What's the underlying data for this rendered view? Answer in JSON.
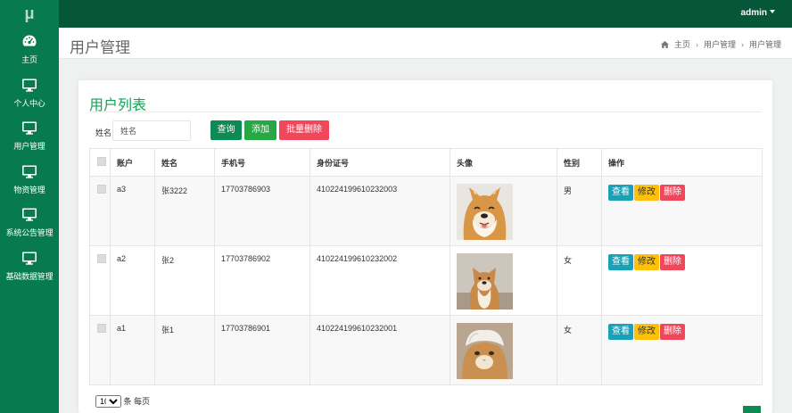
{
  "app": {
    "logo": "μ",
    "user": "admin"
  },
  "sidebar": {
    "items": [
      {
        "label": "主页",
        "icon": "dashboard-icon"
      },
      {
        "label": "个人中心",
        "icon": "monitor-icon"
      },
      {
        "label": "用户管理",
        "icon": "monitor-icon"
      },
      {
        "label": "物资管理",
        "icon": "monitor-icon"
      },
      {
        "label": "系统公告管理",
        "icon": "monitor-icon"
      },
      {
        "label": "基础数据管理",
        "icon": "monitor-icon"
      }
    ]
  },
  "header": {
    "title": "用户管理",
    "breadcrumb": [
      "主页",
      "用户管理",
      "用户管理"
    ]
  },
  "card": {
    "title": "用户列表",
    "search_label": "姓名",
    "search_placeholder": "姓名",
    "btn_query": "查询",
    "btn_add": "添加",
    "btn_bulk_delete": "批量删除"
  },
  "table": {
    "headers": [
      "",
      "账户",
      "姓名",
      "手机号",
      "身份证号",
      "头像",
      "性别",
      "操作"
    ],
    "rows": [
      {
        "account": "a3",
        "name": "张3222",
        "phone": "17703786903",
        "id_card": "410224199610232003",
        "avatar": "shiba-dog-photo",
        "gender": "男"
      },
      {
        "account": "a2",
        "name": "张2",
        "phone": "17703786902",
        "id_card": "410224199610232002",
        "avatar": "shiba-dog-sitting-photo",
        "gender": "女"
      },
      {
        "account": "a1",
        "name": "张1",
        "phone": "17703786901",
        "id_card": "410224199610232001",
        "avatar": "cat-with-towel-photo",
        "gender": "女"
      }
    ],
    "actions": {
      "view": "查看",
      "edit": "修改",
      "delete": "删除"
    }
  },
  "pager": {
    "page_size": "10",
    "page_size_options": [
      "10"
    ],
    "suffix": "条 每页"
  },
  "colors": {
    "sidebar": "#087a4f",
    "topbar": "#06563a",
    "accent": "#15a155"
  }
}
